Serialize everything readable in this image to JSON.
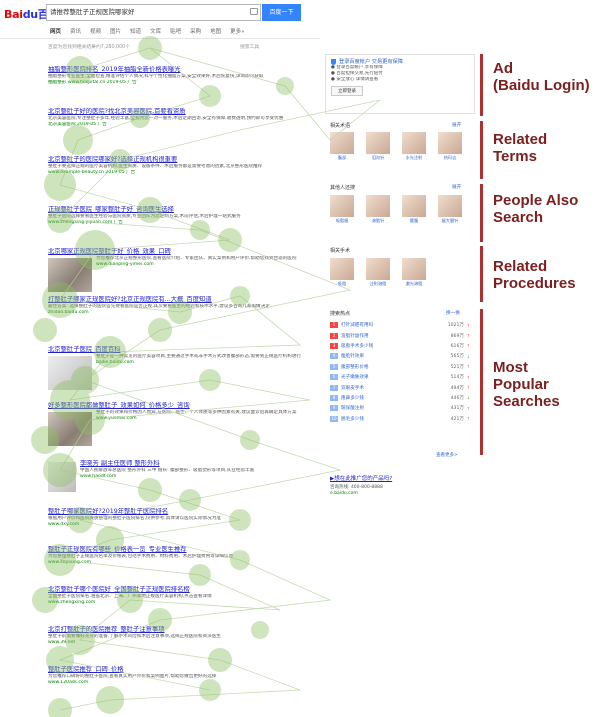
{
  "header": {
    "logo_part1": "Bai",
    "logo_part2": "du百度",
    "search_query": "请推荐整肚子正规医院哪家好",
    "search_button": "百度一下"
  },
  "tabs": [
    "网页",
    "资讯",
    "视频",
    "图片",
    "知道",
    "文库",
    "贴吧",
    "采购",
    "地图",
    "更多»"
  ],
  "result_count": "百度为您找到相关结果约7,280,000个",
  "filter_link": "搜索工具",
  "results": [
    {
      "title": "抽脂整形医院排名_2019年抽脂全新价格表曝光",
      "snippet": "抽脂整形专业医生,全面检查,精准评估个人情况,科学个性化抽脂方案,安全效果好,术后恢复快,详询即可获取",
      "url": "抽脂整形 www.hospital.cn 2019-05 广告"
    },
    {
      "title": "北京整肚子好的医院?找北京美容医院,首要看资质",
      "snippet": "北京美容医院,专注整肚子多年,经验丰富,全程为您一对一服务,术后定期回访,安全有保障,收费透明,预约即可享受优惠",
      "url": "北京美容医院 2019-05 广告"
    },
    {
      "title": "北京整肚子的医院哪家好?选择正规机构很重要",
      "snippet": "整肚子要选择正规的医疗美容机构,医生资质、设备条件、术后服务都是需要考虑的因素,北京整形医院推荐",
      "url": "www.example-beauty.cn 2019-05 广告"
    },
    {
      "title": "正规整肚子医院_哪家整肚子好_咨询医生选择",
      "snippet": "整肚子医院选择要看医生经验与医院资质,专业团队为您定制方案,术前评估,术后护理一站式服务",
      "url": "www.zhengxing-yiyuan.com 广告"
    },
    {
      "title": "北京哪家正规医院整肚子好_价格_效果_口碑",
      "snippet": "为您推荐北京正规整形医院,查看医院介绍、专家团队、真实案例和用户评价,帮助您找到合适的医院",
      "url": "www.dianping-yimei.com"
    },
    {
      "title": "打整肚子哪家正规医院好?北京正规医院有...大概_百度知道",
      "snippet": "最佳答案: 选择整肚子的医院首先要看医院是否正规,其次要看医生的经验和技术水平,建议多咨询几家再做决定",
      "url": "zhidao.baidu.com"
    },
    {
      "title": "北京整肚子医院_百度百科",
      "snippet": "整肚子是一种常见的医疗美容项目,主要通过手术或非手术方式改善腹部形态,需要到正规医疗机构进行",
      "url": "baike.baidu.com"
    },
    {
      "title": "好多整形医院都做整肚子_效果如何_价格多少_咨询",
      "snippet": "整肚子的效果和价格因人而异,与医院、医生、个人体质等多种因素有关,建议面诊后再确定具体方案",
      "url": "www.yuemei.com"
    },
    {
      "title": "李晓芳 副主任医师 整形外科",
      "snippet": "中国人民解放军总医院 整形外科 三甲 擅长: 腹部整形、吸脂塑形等项目,从业经验丰富",
      "url": "www.haodf.com"
    },
    {
      "title": "整肚子哪家医院好?2019年整肚子医院排名",
      "snippet": "根据用户评价和医院资质整理的整肚子医院排名,仅供参考,具体请以医院实际情况为准",
      "url": "www.dxy.com"
    },
    {
      "title": "整肚子正规医院有哪些_价格表一览_专业医生推荐",
      "snippet": "为您整理整肚子正规医院名单及价格表,包括手术费用、材料费用、术后护理费用等详细信息",
      "url": "www.soyoung.com"
    },
    {
      "title": "北京整肚子哪个医院好_全国整肚子正规医院排名榜",
      "snippet": "全国整肚子医院排名,涵盖北京、上海、广州等地正规医疗美容机构,点击查看详情",
      "url": "www.zhengxing.com"
    },
    {
      "title": "北京打整肚子的医院推荐_整肚子注意事项",
      "snippet": "整肚子前需要做好充分的准备,了解手术风险和术后注意事项,选择正规医院和资深医生",
      "url": "www.39.net"
    },
    {
      "title": "整肚子医院推荐_口碑_价格",
      "snippet": "为您推荐口碑好的整肚子医院,查看真实用户评价和案例图片,帮助您做出更好的选择",
      "url": "www.120ask.com"
    }
  ],
  "ad": {
    "title": "登录百度帐户 交易更有保障",
    "lines": [
      "● 登录百度帐户,享有保障",
      "● 百度担保交易,先行赔付",
      "● 安全放心 详情请查看"
    ],
    "button": "立即登录"
  },
  "related_terms": {
    "heading": "相关术语",
    "more": "展开",
    "items": [
      "腹部",
      "泪沟针",
      "水光注射",
      "热玛吉"
    ]
  },
  "people_also": {
    "heading": "其他人还搜",
    "more": "展开",
    "items": [
      "吸脂瘦",
      "溶脂针",
      "腰腹",
      "瘦大腿针"
    ]
  },
  "related_procedures": {
    "heading": "相关手术",
    "items": [
      "吸脂",
      "注射溶脂",
      "激光溶脂"
    ]
  },
  "hot_searches": {
    "heading": "搜索热点",
    "page": "换一换",
    "items": [
      {
        "term": "打针减肥有用吗",
        "count": "1021万",
        "trend": "up"
      },
      {
        "term": "溶脂针副作用",
        "count": "869万",
        "trend": "up"
      },
      {
        "term": "吸脂手术多少钱",
        "count": "616万",
        "trend": "up"
      },
      {
        "term": "瘦脸针效果",
        "count": "565万",
        "trend": "down"
      },
      {
        "term": "腹部整形价格",
        "count": "521万",
        "trend": "up"
      },
      {
        "term": "光子嫩肤效果",
        "count": "514万",
        "trend": "up"
      },
      {
        "term": "双眼皮手术",
        "count": "494万",
        "trend": "up"
      },
      {
        "term": "隆鼻多少钱",
        "count": "446万",
        "trend": "down"
      },
      {
        "term": "玻尿酸注射",
        "count": "431万",
        "trend": "up"
      },
      {
        "term": "脱毛多少钱",
        "count": "421万",
        "trend": "up"
      }
    ],
    "more": "查看更多>"
  },
  "biz": {
    "link": "▶想在此推广您的产品吗?",
    "phone": "咨询热线: 400-800-8888",
    "domain": "e.baidu.com"
  },
  "annotations": [
    {
      "line1": "Ad",
      "line2": "(Baidu Login)"
    },
    {
      "line1": "Related",
      "line2": "Terms"
    },
    {
      "line1": "People Also",
      "line2": "Search"
    },
    {
      "line1": "Related",
      "line2": "Procedures"
    },
    {
      "line1": "Most",
      "line2": "Popular",
      "line3": "Searches"
    }
  ],
  "colors": {
    "annotation": "#7b2121",
    "annotation_bar": "#b03030",
    "baidu_blue": "#3385ff",
    "link": "#2222cc",
    "url_green": "#008000",
    "heat": "#8cc063"
  }
}
